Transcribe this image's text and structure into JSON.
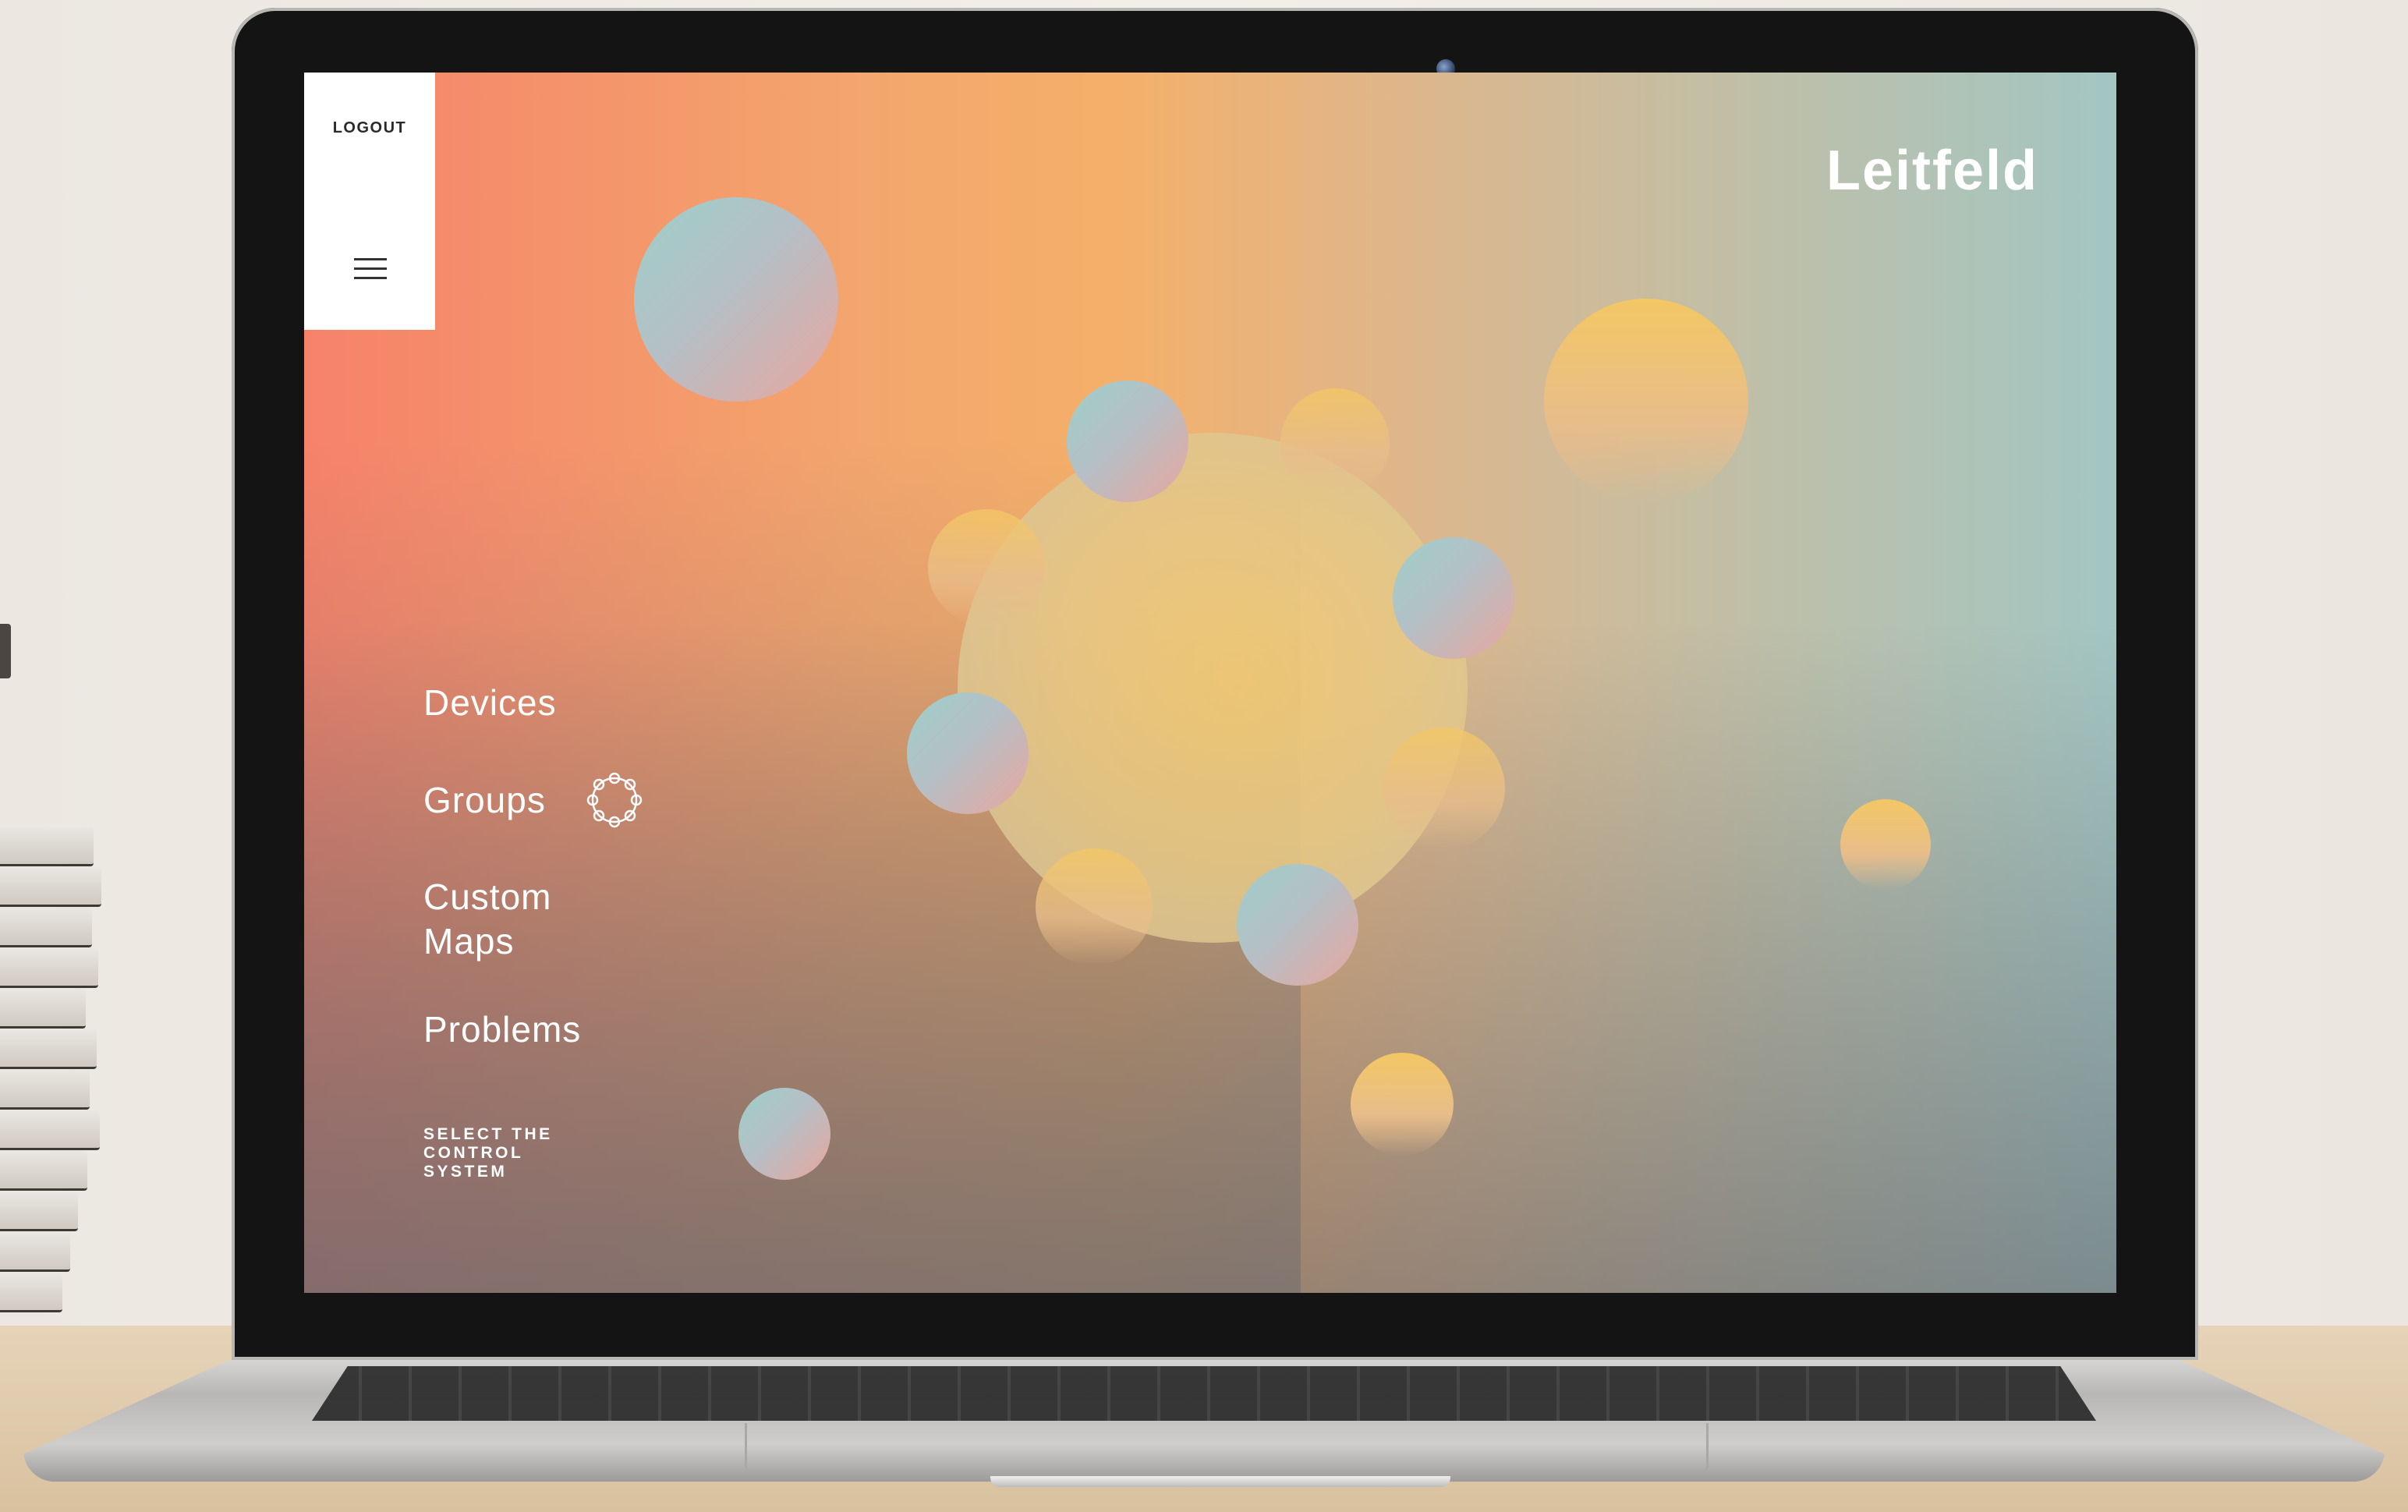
{
  "app": {
    "brand": "Leitfeld"
  },
  "menu_panel": {
    "logout_label": "LOGOUT",
    "menu_icon": "hamburger-menu-icon"
  },
  "nav": {
    "items": [
      {
        "label": "Devices"
      },
      {
        "label": "Groups",
        "icon": "ring-network-icon"
      },
      {
        "label": "Custom Maps"
      },
      {
        "label": "Problems"
      }
    ]
  },
  "footer_note": "SELECT THE CONTROL SYSTEM",
  "colors": {
    "gradient_left": "#f6826a",
    "gradient_mid": "#f4b06a",
    "gradient_right": "#a3c6c3",
    "panel": "#ffffff",
    "text": "#ffffff"
  }
}
